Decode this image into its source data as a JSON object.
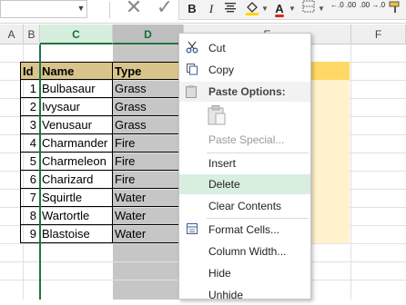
{
  "ribbon": {
    "cancel_glyph": "✕",
    "enter_glyph": "✓",
    "bold": "B",
    "italic": "I",
    "font_color_letter": "A",
    "decimals_increase": "←.0 .00",
    "decimals_decrease": ".00 →.0",
    "font_color_accent": "#e2231a"
  },
  "columns": [
    "A",
    "B",
    "C",
    "D",
    "E",
    "F"
  ],
  "table": {
    "headers": [
      "Id",
      "Name",
      "Type"
    ],
    "rows": [
      [
        "1",
        "Bulbasaur",
        "Grass"
      ],
      [
        "2",
        "Ivysaur",
        "Grass"
      ],
      [
        "3",
        "Venusaur",
        "Grass"
      ],
      [
        "4",
        "Charmander",
        "Fire"
      ],
      [
        "5",
        "Charmeleon",
        "Fire"
      ],
      [
        "6",
        "Charizard",
        "Fire"
      ],
      [
        "7",
        "Squirtle",
        "Water"
      ],
      [
        "8",
        "Wartortle",
        "Water"
      ],
      [
        "9",
        "Blastoise",
        "Water"
      ]
    ]
  },
  "context_menu": {
    "cut": "Cut",
    "copy": "Copy",
    "paste_options": "Paste Options:",
    "paste_special": "Paste Special...",
    "insert": "Insert",
    "delete": "Delete",
    "clear_contents": "Clear Contents",
    "format_cells": "Format Cells...",
    "column_width": "Column Width...",
    "hide": "Hide",
    "unhide": "Unhide"
  },
  "colors": {
    "accent_green": "#217346",
    "highlight": "#d8efe0",
    "header_fill": "#d9c58b",
    "selection_gray": "#c6c6c6"
  }
}
